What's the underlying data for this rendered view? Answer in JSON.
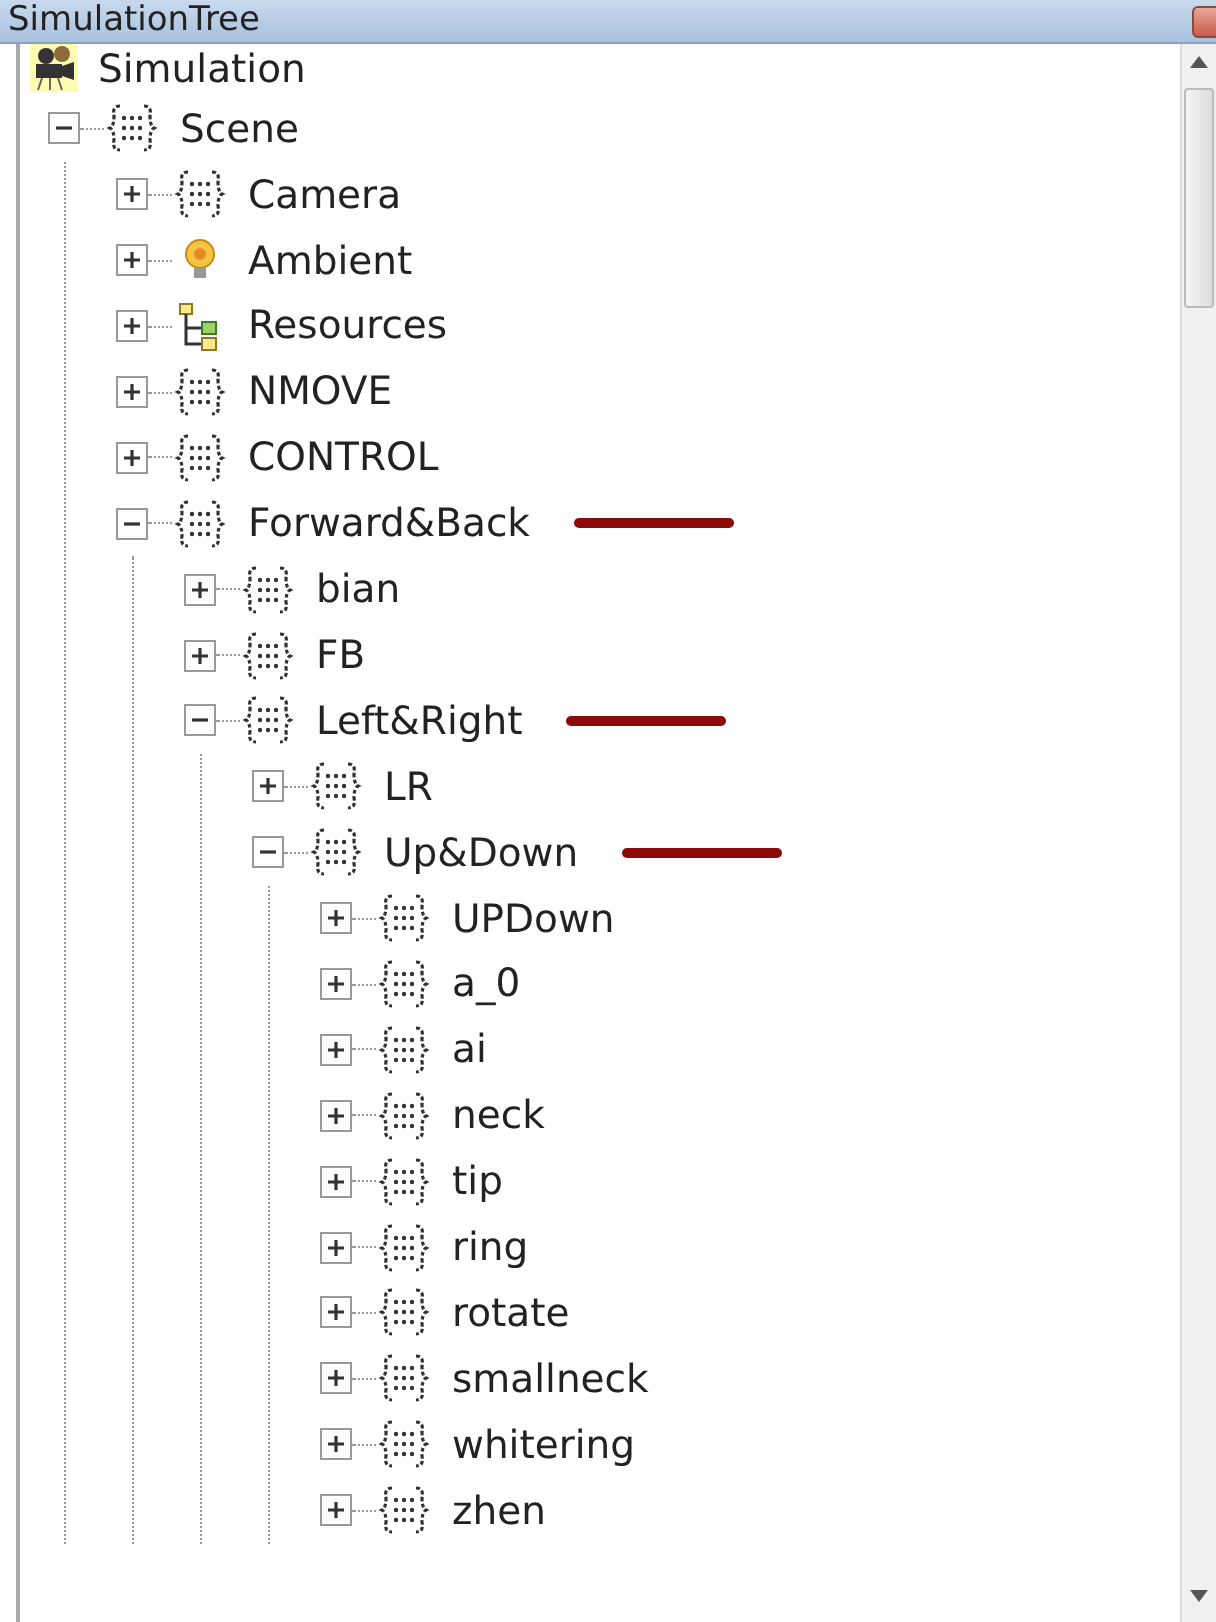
{
  "title": "SimulationTree",
  "tree": [
    {
      "label": "Simulation",
      "kind": "camera",
      "annotated": false,
      "children": [
        {
          "label": "Scene",
          "kind": "node",
          "expanded": true,
          "annotated": false,
          "children": [
            {
              "label": "Camera",
              "kind": "node",
              "expanded": false,
              "annotated": false
            },
            {
              "label": "Ambient",
              "kind": "bulb",
              "expanded": false,
              "annotated": false
            },
            {
              "label": "Resources",
              "kind": "resources",
              "expanded": false,
              "annotated": false
            },
            {
              "label": "NMOVE",
              "kind": "node",
              "expanded": false,
              "annotated": false
            },
            {
              "label": "CONTROL",
              "kind": "node",
              "expanded": false,
              "annotated": false
            },
            {
              "label": "Forward&Back",
              "kind": "node",
              "expanded": true,
              "annotated": true,
              "children": [
                {
                  "label": "bian",
                  "kind": "node",
                  "expanded": false,
                  "annotated": false
                },
                {
                  "label": "FB",
                  "kind": "node",
                  "expanded": false,
                  "annotated": false
                },
                {
                  "label": "Left&Right",
                  "kind": "node",
                  "expanded": true,
                  "annotated": true,
                  "children": [
                    {
                      "label": "LR",
                      "kind": "node",
                      "expanded": false,
                      "annotated": false
                    },
                    {
                      "label": "Up&Down",
                      "kind": "node",
                      "expanded": true,
                      "annotated": true,
                      "children": [
                        {
                          "label": "UPDown",
                          "kind": "node",
                          "expanded": false,
                          "annotated": false
                        },
                        {
                          "label": "a_0",
                          "kind": "node",
                          "expanded": false,
                          "annotated": false
                        },
                        {
                          "label": "ai",
                          "kind": "node",
                          "expanded": false,
                          "annotated": false
                        },
                        {
                          "label": "neck",
                          "kind": "node",
                          "expanded": false,
                          "annotated": false
                        },
                        {
                          "label": "tip",
                          "kind": "node",
                          "expanded": false,
                          "annotated": false
                        },
                        {
                          "label": "ring",
                          "kind": "node",
                          "expanded": false,
                          "annotated": false
                        },
                        {
                          "label": "rotate",
                          "kind": "node",
                          "expanded": false,
                          "annotated": false
                        },
                        {
                          "label": "smallneck",
                          "kind": "node",
                          "expanded": false,
                          "annotated": false
                        },
                        {
                          "label": "whitering",
                          "kind": "node",
                          "expanded": false,
                          "annotated": false
                        },
                        {
                          "label": "zhen",
                          "kind": "node",
                          "expanded": false,
                          "annotated": false
                        }
                      ]
                    }
                  ]
                }
              ]
            }
          ]
        }
      ]
    }
  ]
}
